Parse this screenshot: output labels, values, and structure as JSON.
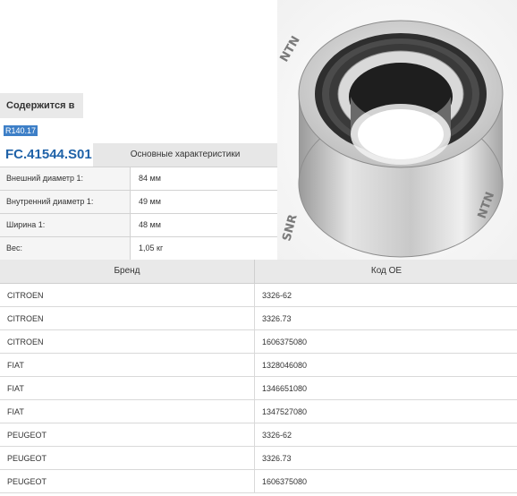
{
  "contained": {
    "label": "Содержится в",
    "link": "R140.17"
  },
  "specs": {
    "code": "FC.41544.S01",
    "title": "Основные характеристики",
    "rows": [
      {
        "key": "Внешний диаметр 1:",
        "value": "84 мм"
      },
      {
        "key": "Внутренний диаметр 1:",
        "value": "49 мм"
      },
      {
        "key": "Ширина 1:",
        "value": "48 мм"
      },
      {
        "key": "Вес:",
        "value": "1,05 кг"
      }
    ]
  },
  "oe": {
    "headers": [
      "Бренд",
      "Код OE"
    ],
    "rows": [
      {
        "brand": "CITROEN",
        "code": "3326-62"
      },
      {
        "brand": "CITROEN",
        "code": "3326.73"
      },
      {
        "brand": "CITROEN",
        "code": "1606375080"
      },
      {
        "brand": "FIAT",
        "code": "1328046080"
      },
      {
        "brand": "FIAT",
        "code": "1346651080"
      },
      {
        "brand": "FIAT",
        "code": "1347527080"
      },
      {
        "brand": "PEUGEOT",
        "code": "3326-62"
      },
      {
        "brand": "PEUGEOT",
        "code": "3326.73"
      },
      {
        "brand": "PEUGEOT",
        "code": "1606375080"
      }
    ]
  },
  "image": {
    "brand_mark": "NTN",
    "colors": {
      "metal_light": "#e6e6e6",
      "metal_mid": "#b5b5b5",
      "metal_dark": "#4a4a4a",
      "seal": "#2c2c2c"
    }
  }
}
